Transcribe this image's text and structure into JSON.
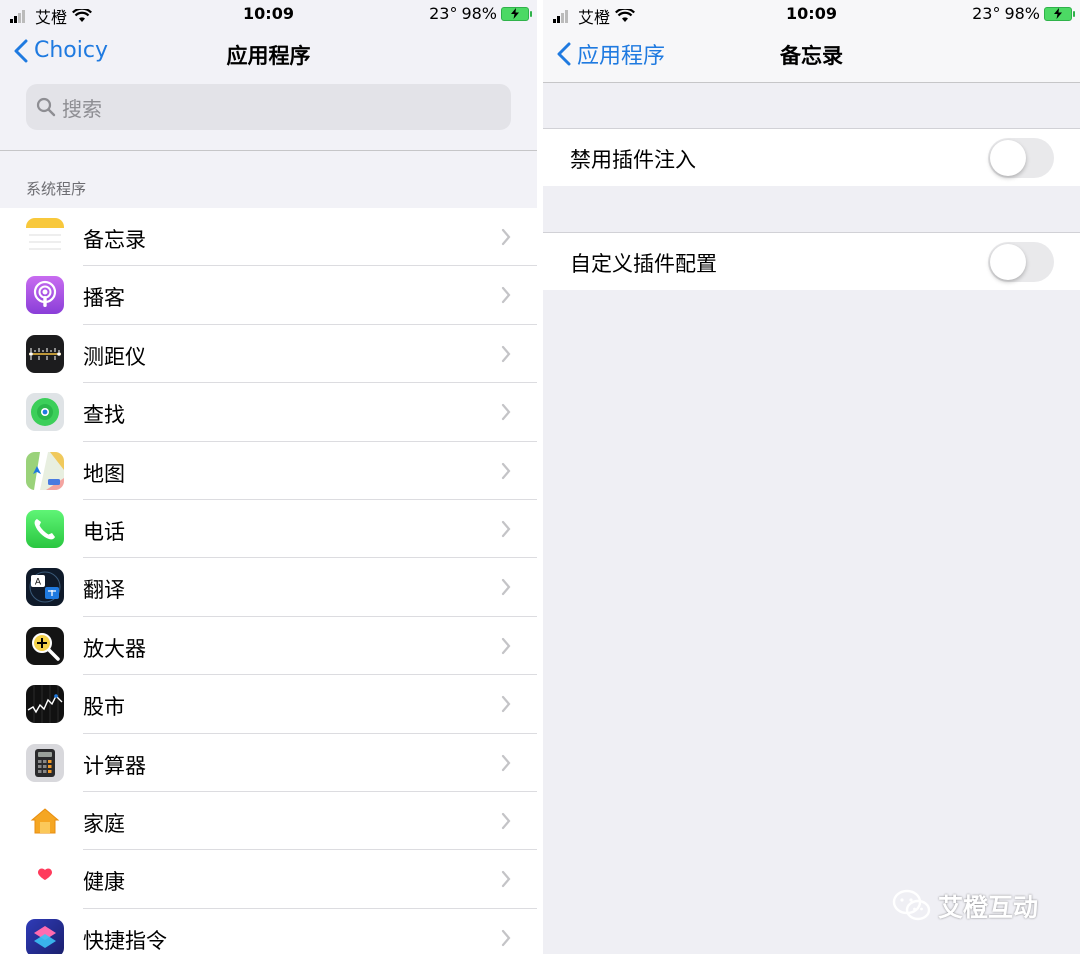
{
  "left": {
    "status": {
      "carrier": "艾橙",
      "time": "10:09",
      "temp": "23°",
      "battery": "98%"
    },
    "nav": {
      "back_label": "Choicy",
      "title": "应用程序"
    },
    "search": {
      "placeholder": "搜索"
    },
    "section": "系统程序",
    "apps": [
      {
        "label": "备忘录",
        "icon": "notes-icon"
      },
      {
        "label": "播客",
        "icon": "podcasts-icon"
      },
      {
        "label": "测距仪",
        "icon": "measure-icon"
      },
      {
        "label": "查找",
        "icon": "find-my-icon"
      },
      {
        "label": "地图",
        "icon": "maps-icon"
      },
      {
        "label": "电话",
        "icon": "phone-icon"
      },
      {
        "label": "翻译",
        "icon": "translate-icon"
      },
      {
        "label": "放大器",
        "icon": "magnifier-icon"
      },
      {
        "label": "股市",
        "icon": "stocks-icon"
      },
      {
        "label": "计算器",
        "icon": "calculator-icon"
      },
      {
        "label": "家庭",
        "icon": "home-icon"
      },
      {
        "label": "健康",
        "icon": "health-icon"
      },
      {
        "label": "快捷指令",
        "icon": "shortcuts-icon"
      }
    ]
  },
  "right": {
    "status": {
      "carrier": "艾橙",
      "time": "10:09",
      "temp": "23°",
      "battery": "98%"
    },
    "nav": {
      "back_label": "应用程序",
      "title": "备忘录"
    },
    "settings": [
      {
        "label": "禁用插件注入",
        "on": false
      },
      {
        "label": "自定义插件配置",
        "on": false
      }
    ]
  },
  "watermark": "艾橙互动",
  "colors": {
    "accent": "#1f7ae0",
    "toggle_off": "#e9e9eb",
    "battery": "#4cd964"
  }
}
